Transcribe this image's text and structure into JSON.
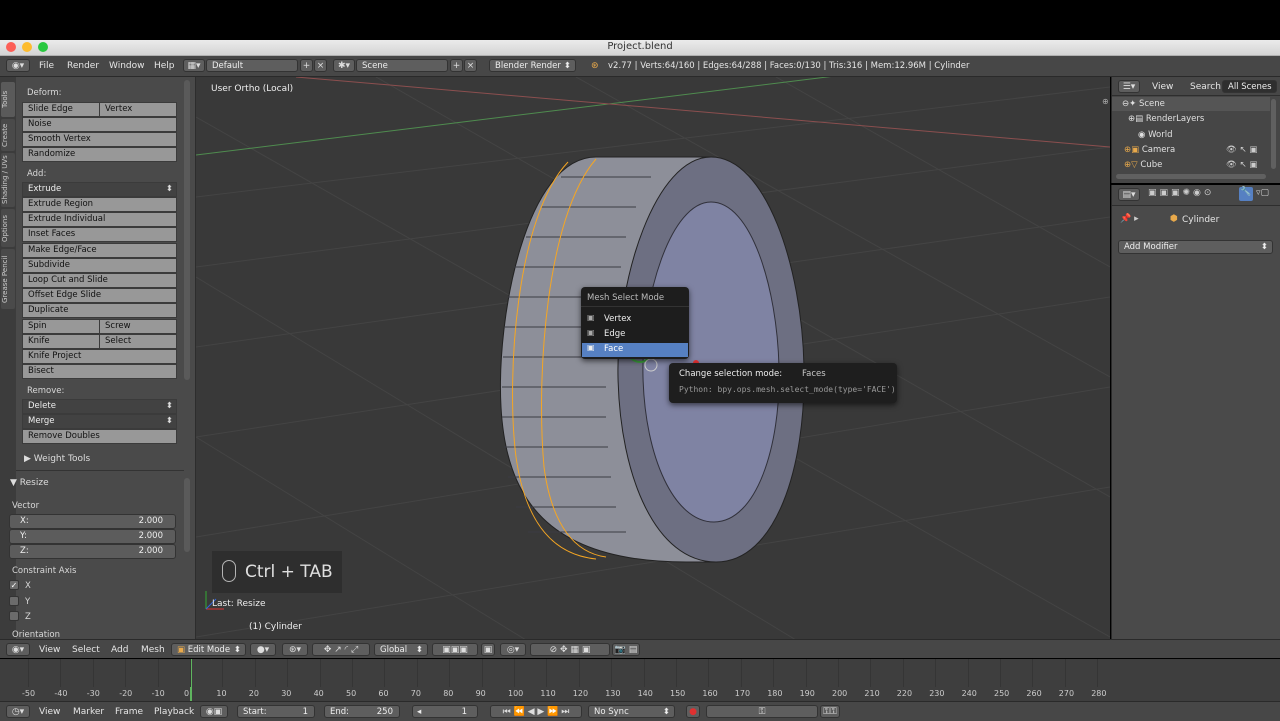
{
  "window": {
    "title": "Project.blend"
  },
  "header": {
    "menus": [
      "File",
      "Render",
      "Window",
      "Help"
    ],
    "layout": "Default",
    "scene": "Scene",
    "engine": "Blender Render",
    "stats": "v2.77 | Verts:64/160 | Edges:64/288 | Faces:0/130 | Tris:316 | Mem:12.96M | Cylinder"
  },
  "toolshelf": {
    "tabs": [
      "Tools",
      "Create",
      "Shading / UVs",
      "Options",
      "Grease Pencil"
    ],
    "deform_label": "Deform:",
    "slide_edge": "Slide Edge",
    "vertex": "Vertex",
    "noise": "Noise",
    "smooth_vertex": "Smooth Vertex",
    "randomize": "Randomize",
    "add_label": "Add:",
    "extrude": "Extrude",
    "extrude_region": "Extrude Region",
    "extrude_individual": "Extrude Individual",
    "inset_faces": "Inset Faces",
    "make_edge_face": "Make Edge/Face",
    "subdivide": "Subdivide",
    "loop_cut": "Loop Cut and Slide",
    "offset_edge": "Offset Edge Slide",
    "duplicate": "Duplicate",
    "spin": "Spin",
    "screw": "Screw",
    "knife": "Knife",
    "select": "Select",
    "knife_project": "Knife Project",
    "bisect": "Bisect",
    "remove_label": "Remove:",
    "delete": "Delete",
    "merge": "Merge",
    "remove_doubles": "Remove Doubles",
    "weight_tools": "Weight Tools",
    "resize_panel": "Resize",
    "vector_label": "Vector",
    "x_label": "X:",
    "x_value": "2.000",
    "y_label": "Y:",
    "y_value": "2.000",
    "z_label": "Z:",
    "z_value": "2.000",
    "constraint_label": "Constraint Axis",
    "cx": "X",
    "cy": "Y",
    "cz": "Z",
    "orientation_label": "Orientation"
  },
  "viewport": {
    "view_name": "User Ortho (Local)",
    "last_op": "Last: Resize",
    "object_info": "(1) Cylinder",
    "shortcut": "Ctrl + TAB"
  },
  "select_menu": {
    "title": "Mesh Select Mode",
    "items": [
      "Vertex",
      "Edge",
      "Face"
    ]
  },
  "tooltip": {
    "label": "Change selection mode:",
    "value": "Faces",
    "python": "Python: bpy.ops.mesh.select_mode(type='FACE')"
  },
  "outliner": {
    "view": "View",
    "search": "Search",
    "all_scenes": "All Scenes",
    "items": [
      "Scene",
      "RenderLayers",
      "World",
      "Camera",
      "Cube"
    ]
  },
  "properties": {
    "object": "Cylinder",
    "add_modifier": "Add Modifier"
  },
  "view3d_header": {
    "view": "View",
    "select": "Select",
    "add": "Add",
    "mesh": "Mesh",
    "mode": "Edit Mode",
    "orientation": "Global"
  },
  "timeline": {
    "ticks": [
      "-50",
      "-40",
      "-30",
      "-20",
      "-10",
      "0",
      "10",
      "20",
      "30",
      "40",
      "50",
      "60",
      "70",
      "80",
      "90",
      "100",
      "110",
      "120",
      "130",
      "140",
      "150",
      "160",
      "170",
      "180",
      "190",
      "200",
      "210",
      "220",
      "230",
      "240",
      "250",
      "260",
      "270",
      "280"
    ],
    "current_frame": 1
  },
  "timeline_header": {
    "view": "View",
    "marker": "Marker",
    "frame": "Frame",
    "playback": "Playback",
    "start_label": "Start:",
    "start": "1",
    "end_label": "End:",
    "end": "250",
    "current": "1",
    "sync": "No Sync"
  },
  "colors": {
    "highlight": "#5680c2",
    "selected_edge": "#f5a623"
  }
}
